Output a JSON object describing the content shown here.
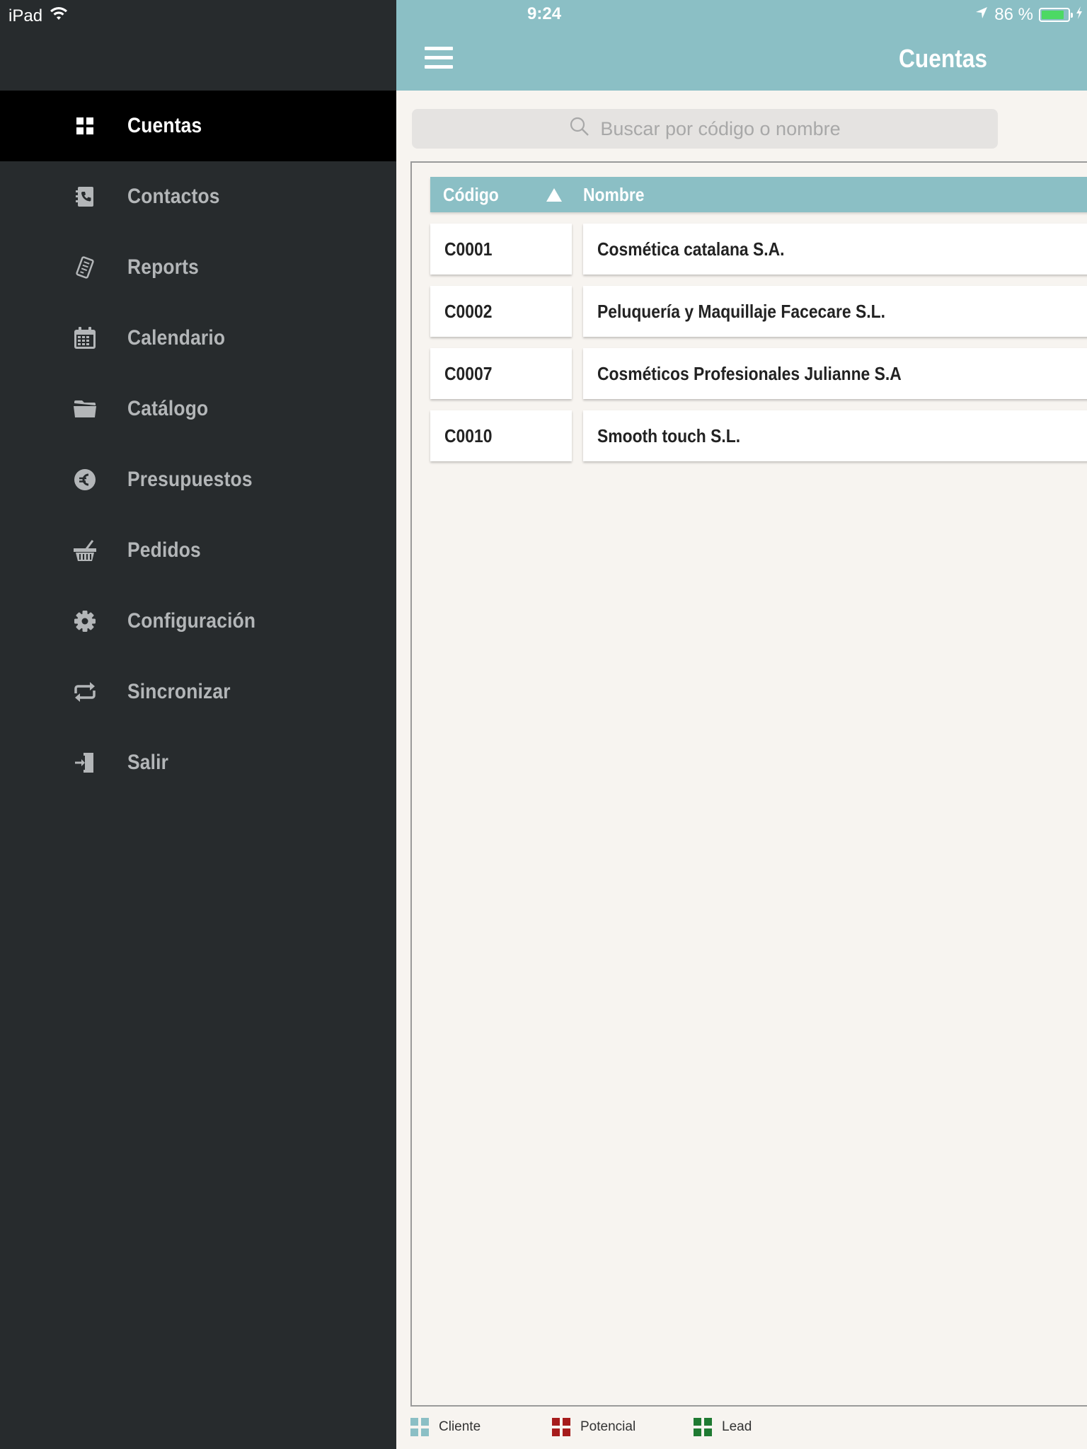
{
  "status": {
    "device": "iPad",
    "time": "9:24",
    "battery": "86 %",
    "battery_level": 0.86
  },
  "header": {
    "title": "Cuentas"
  },
  "sidebar": {
    "items": [
      {
        "label": "Cuentas",
        "icon": "grid-icon",
        "active": true
      },
      {
        "label": "Contactos",
        "icon": "contacts-book-icon"
      },
      {
        "label": "Reports",
        "icon": "report-icon"
      },
      {
        "label": "Calendario",
        "icon": "calendar-icon"
      },
      {
        "label": "Catálogo",
        "icon": "folder-icon"
      },
      {
        "label": "Presupuestos",
        "icon": "euro-icon"
      },
      {
        "label": "Pedidos",
        "icon": "basket-icon"
      },
      {
        "label": "Configuración",
        "icon": "gear-icon"
      },
      {
        "label": "Sincronizar",
        "icon": "sync-icon"
      },
      {
        "label": "Salir",
        "icon": "exit-icon"
      }
    ]
  },
  "search": {
    "placeholder": "Buscar por código o nombre"
  },
  "table": {
    "columns": {
      "code": "Código",
      "name": "Nombre"
    },
    "rows": [
      {
        "code": "C0001",
        "name": "Cosmética catalana S.A."
      },
      {
        "code": "C0002",
        "name": "Peluquería y Maquillaje Facecare S.L."
      },
      {
        "code": "C0007",
        "name": "Cosméticos Profesionales Julianne S.A"
      },
      {
        "code": "C0010",
        "name": "Smooth touch S.L."
      }
    ]
  },
  "legend": {
    "items": [
      {
        "label": "Cliente",
        "color": "#8bbfc5"
      },
      {
        "label": "Potencial",
        "color": "#a61c1c"
      },
      {
        "label": "Lead",
        "color": "#1f7a32"
      }
    ]
  },
  "colors": {
    "accent": "#8bbfc5",
    "sidebar_bg": "#272b2d",
    "active_bg": "#000000"
  }
}
